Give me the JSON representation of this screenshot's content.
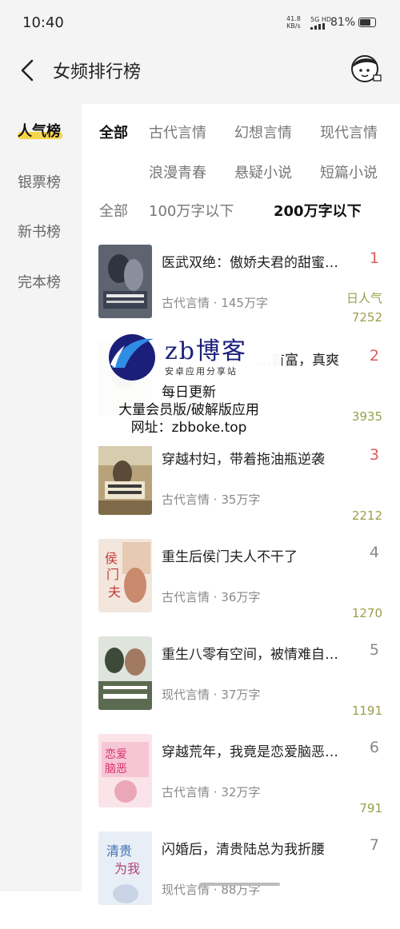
{
  "status": {
    "time": "10:40",
    "net_speed": "41.8",
    "net_unit": "KB/s",
    "sig": "5G HD",
    "battery": "81%",
    "battery_level": 0.81
  },
  "header": {
    "title": "女频排行榜",
    "back_icon": "chevron-left-icon",
    "avatar_icon": "user-avatar-icon"
  },
  "sidebar": {
    "items": [
      {
        "label": "人气榜"
      },
      {
        "label": "银票榜"
      },
      {
        "label": "新书榜"
      },
      {
        "label": "完本榜"
      }
    ]
  },
  "genre_tabs": [
    "全部",
    "古代言情",
    "幻想言情",
    "现代言情",
    "浪漫青春",
    "悬疑小说",
    "短篇小说"
  ],
  "length_tabs": [
    "全部",
    "100万字以下",
    "200万字以下"
  ],
  "list": {
    "pop_label": "日人气"
  },
  "books": [
    {
      "title": "医武双绝：傲娇夫君的甜蜜…",
      "genre": "古代言情",
      "words": "145万字",
      "rank": "1",
      "pop": "7252"
    },
    {
      "title": "…首富，真爽",
      "genre": "",
      "words": "",
      "rank": "2",
      "pop": "3935"
    },
    {
      "title": "穿越村妇，带着拖油瓶逆袭",
      "genre": "古代言情",
      "words": "35万字",
      "rank": "3",
      "pop": "2212"
    },
    {
      "title": "重生后侯门夫人不干了",
      "genre": "古代言情",
      "words": "36万字",
      "rank": "4",
      "pop": "1270"
    },
    {
      "title": "重生八零有空间，被情难自…",
      "genre": "现代言情",
      "words": "37万字",
      "rank": "5",
      "pop": "1191"
    },
    {
      "title": "穿越荒年，我竟是恋爱脑恶…",
      "genre": "古代言情",
      "words": "32万字",
      "rank": "6",
      "pop": "791"
    },
    {
      "title": "闪婚后，清贵陆总为我折腰",
      "genre": "现代言情",
      "words": "88万字",
      "rank": "7",
      "pop": ""
    }
  ],
  "watermark": {
    "brand": "zb博客",
    "sub": "安卓应用分享站",
    "line1": "每日更新",
    "line2": "大量会员版/破解版应用",
    "line3": "网址：zbboke.top"
  },
  "colors": {
    "rank_top": "#e05a5a",
    "rank_other": "#888888",
    "pop": "#9aa04a",
    "highlight": "#f6d54a"
  }
}
